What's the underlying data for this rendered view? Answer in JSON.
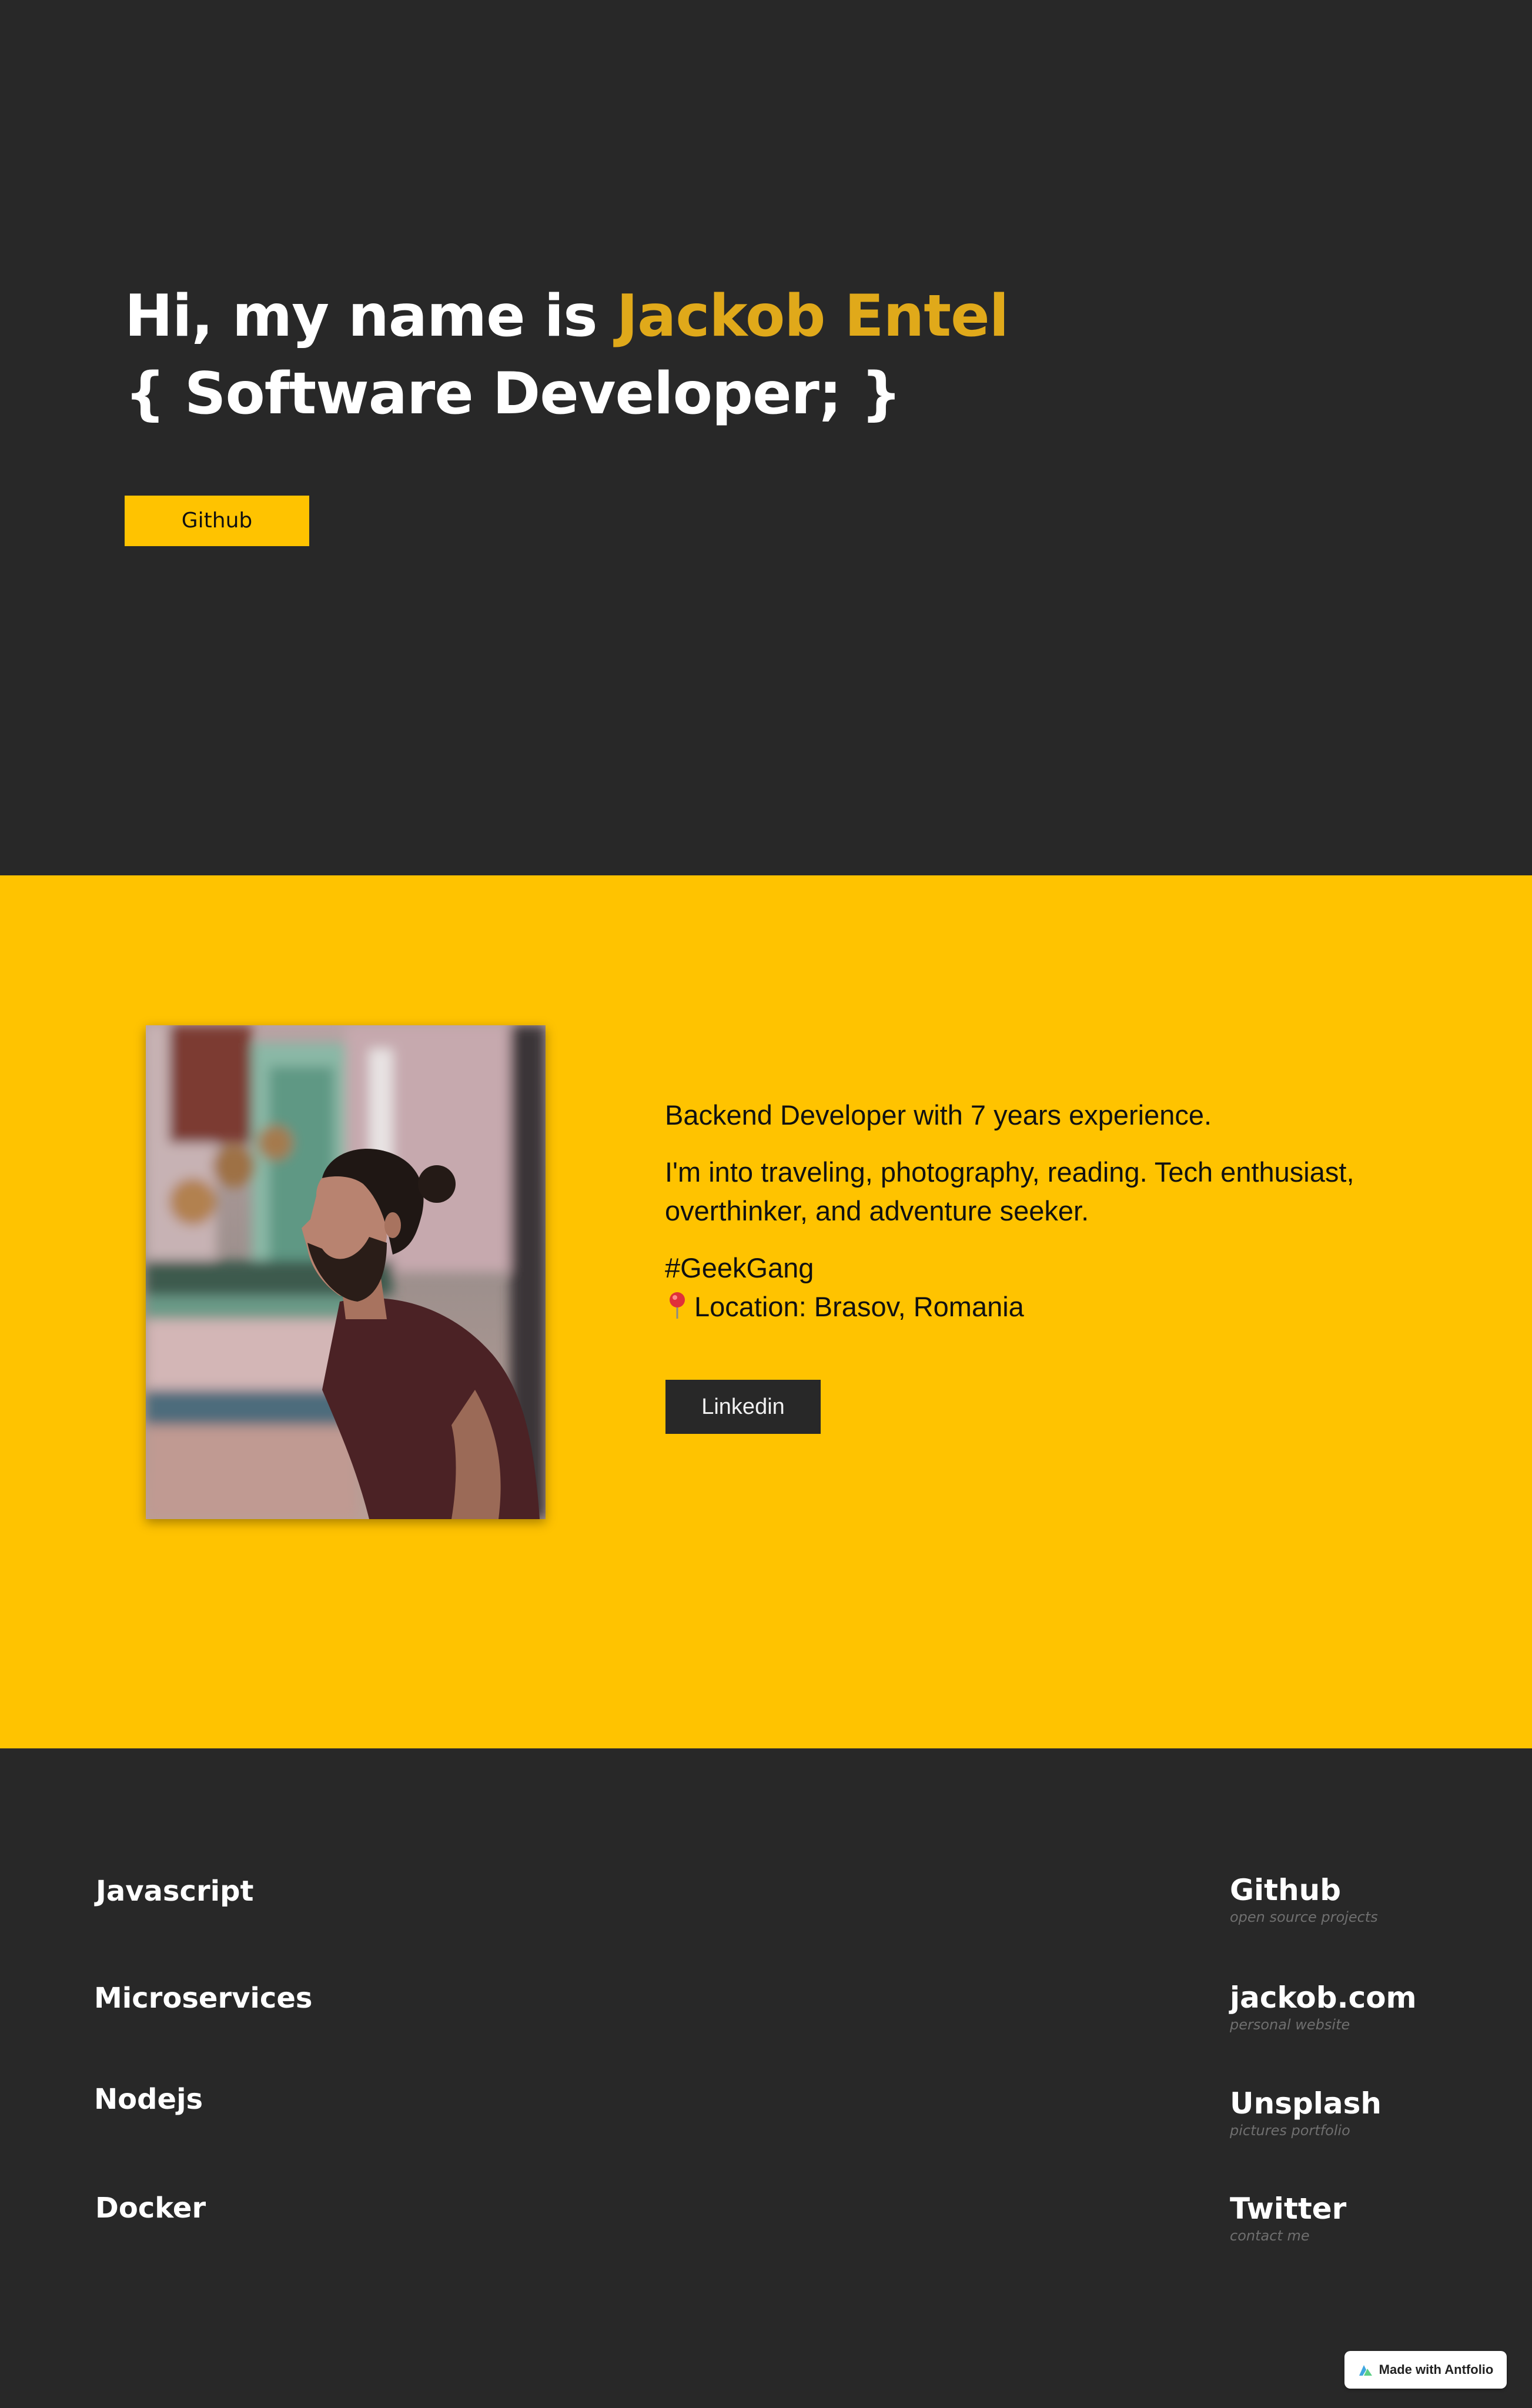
{
  "hero": {
    "greeting": "Hi, my name is ",
    "name": "Jackob Entel",
    "title": "{ Software Developer; }",
    "github_button": "Github"
  },
  "about": {
    "portrait_icon": "person-photo",
    "line1": "Backend Developer with 7 years experience.",
    "line2": "I'm into traveling, photography, reading. Tech enthusiast, overthinker, and adventure seeker.",
    "hashtag": "#GeekGang",
    "location": "Location: Brasov, Romania",
    "location_icon": "pin-icon",
    "linkedin_button": "Linkedin"
  },
  "skills": [
    "Javascript",
    "Microservices",
    "Nodejs",
    "Docker"
  ],
  "links": [
    {
      "title": "Github",
      "subtitle": "open source projects"
    },
    {
      "title": "jackob.com",
      "subtitle": "personal website"
    },
    {
      "title": "Unsplash",
      "subtitle": "pictures portfolio"
    },
    {
      "title": "Twitter",
      "subtitle": "contact me"
    }
  ],
  "badge": {
    "label": "Made with Antfolio",
    "icon": "antfolio-icon"
  },
  "colors": {
    "dark": "#282828",
    "accent_yellow": "#ffc300",
    "name_gold": "#e0a91a",
    "muted_text": "#6f6f6f"
  }
}
